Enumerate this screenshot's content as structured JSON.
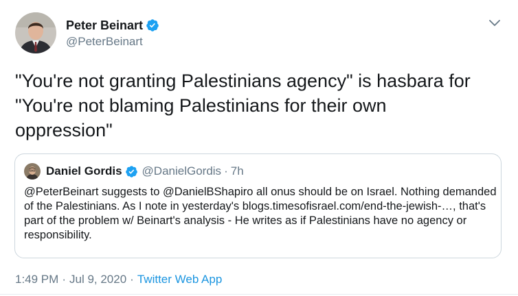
{
  "author": {
    "name": "Peter Beinart",
    "handle": "@PeterBeinart",
    "verified": true
  },
  "icons": {
    "verified": "verified-badge-icon",
    "more": "chevron-down-icon"
  },
  "colors": {
    "verified": "#1da1f2",
    "link": "#1b95e0",
    "secondary_text": "#657786",
    "card_border": "#ccd6dd"
  },
  "tweet": {
    "text": "\"You're not granting Palestinians agency\" is hasbara for\n\"You're not blaming Palestinians for their own\noppression\""
  },
  "quoted_tweet": {
    "name": "Daniel Gordis",
    "handle": "@DanielGordis",
    "separator": "·",
    "time": "7h",
    "text": "@PeterBeinart suggests to @DanielBShapiro all onus should be on Israel. Nothing demanded of the Palestinians. As I note in yesterday's blogs.timesofisrael.com/end-the-jewish-…, that's part of the problem w/ Beinart's analysis - He writes as if Palestinians have no agency or responsibility."
  },
  "footer": {
    "time": "1:49 PM",
    "separator_1": "·",
    "date": "Jul 9, 2020",
    "separator_2": "·",
    "source": "Twitter Web App"
  }
}
